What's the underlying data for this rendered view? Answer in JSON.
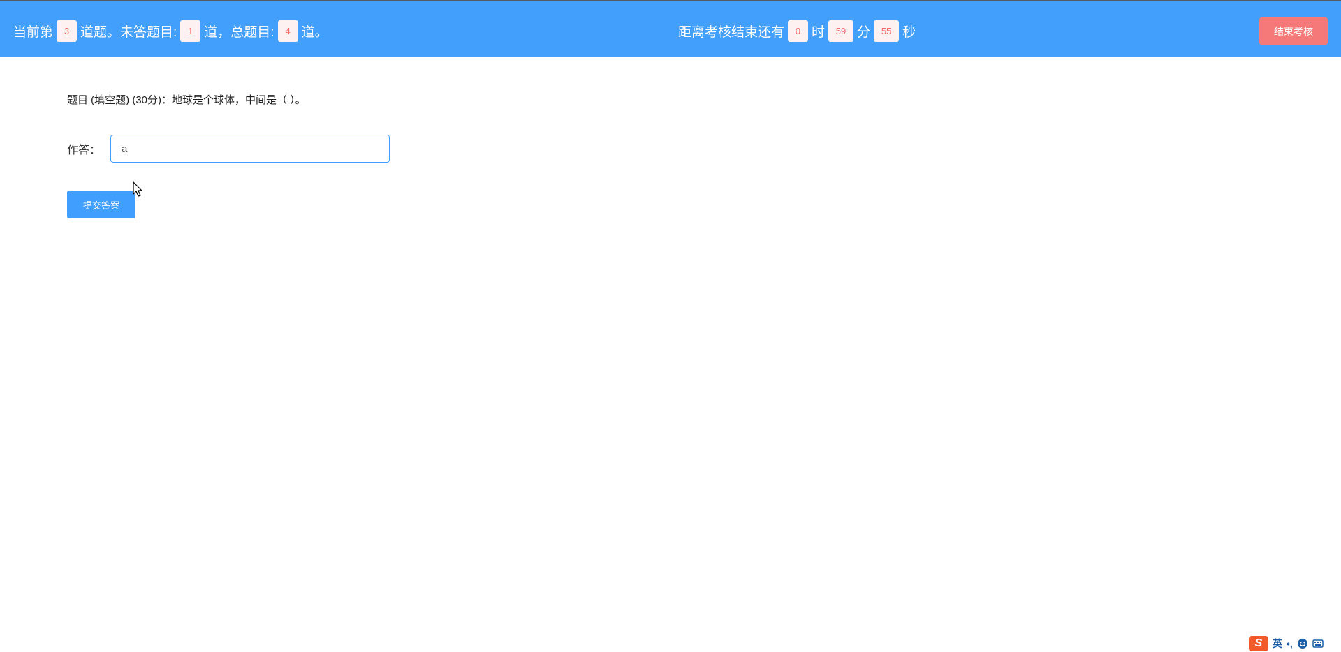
{
  "header": {
    "prefix": "当前第",
    "current_question": "3",
    "mid1": "道题。未答题目:",
    "unanswered": "1",
    "mid2": "道，总题目:",
    "total": "4",
    "suffix": "道。",
    "timer_prefix": "距离考核结束还有",
    "hours": "0",
    "hours_unit": "时",
    "minutes": "59",
    "minutes_unit": "分",
    "seconds": "55",
    "seconds_unit": "秒",
    "end_button": "结束考核"
  },
  "question": {
    "text": "题目 (填空题) (30分)：地球是个球体，中间是（ ）。"
  },
  "answer": {
    "label": "作答：",
    "value": "a"
  },
  "submit_button": "提交答案",
  "ime": {
    "logo": "S",
    "language": "英",
    "punct": "•,"
  },
  "colors": {
    "header_bg": "#429ffc",
    "end_button_bg": "#f67979",
    "primary": "#409eff",
    "badge_text": "#f26b6b"
  }
}
